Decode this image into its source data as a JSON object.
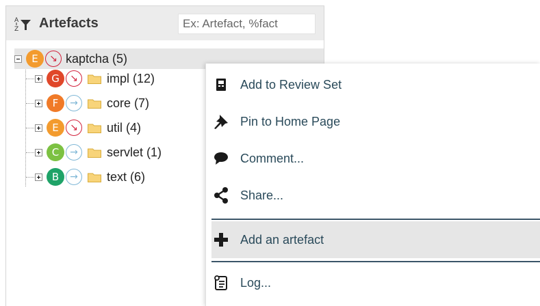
{
  "panel": {
    "title": "Artefacts",
    "search_placeholder": "Ex: Artefact, %fact"
  },
  "tree": {
    "root": {
      "grade": "E",
      "grade_color": "#f39b2e",
      "trend": "down",
      "label": "kaptcha (5)"
    },
    "children": [
      {
        "grade": "G",
        "grade_color": "#e0472a",
        "trend": "down",
        "label": "impl (12)"
      },
      {
        "grade": "F",
        "grade_color": "#f07a28",
        "trend": "right",
        "label": "core (7)"
      },
      {
        "grade": "E",
        "grade_color": "#f39b2e",
        "trend": "down",
        "label": "util (4)"
      },
      {
        "grade": "C",
        "grade_color": "#7cc142",
        "trend": "right",
        "label": "servlet (1)"
      },
      {
        "grade": "B",
        "grade_color": "#1fa368",
        "trend": "right",
        "label": "text (6)"
      }
    ]
  },
  "context_menu": {
    "items": [
      {
        "icon": "review-set-icon",
        "label": "Add to Review Set"
      },
      {
        "icon": "pin-icon",
        "label": "Pin to Home Page"
      },
      {
        "icon": "comment-icon",
        "label": "Comment..."
      },
      {
        "icon": "share-icon",
        "label": "Share..."
      },
      {
        "icon": "plus-icon",
        "label": "Add an artefact"
      },
      {
        "icon": "log-icon",
        "label": "Log..."
      }
    ],
    "active_item": "Add an artefact",
    "colors": {
      "label": "#2a4a5a",
      "separator": "#3b5568",
      "active_bg": "#e6e6e6"
    }
  }
}
